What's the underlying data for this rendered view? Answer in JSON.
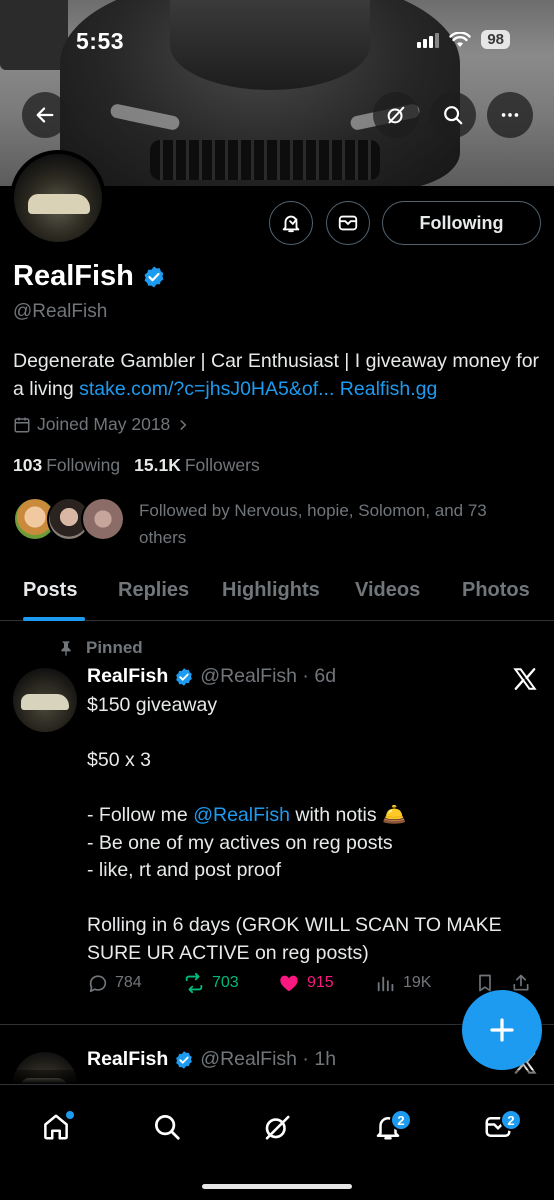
{
  "status_bar": {
    "time": "5:53",
    "battery": "98"
  },
  "profile": {
    "name": "RealFish",
    "handle": "@RealFish",
    "bio_text": "Degenerate Gambler | Car Enthusiast | I giveaway money for a living ",
    "bio_link1": "stake.com/?c=jhsJ0HA5&of...",
    "bio_link2": "Realfish.gg",
    "joined": "Joined May 2018",
    "following_count": "103",
    "following_label": "Following",
    "followers_count": "15.1K",
    "followers_label": "Followers",
    "followed_by": "Followed by Nervous, hopie, Solomon, and 73 others",
    "follow_button": "Following"
  },
  "tabs": [
    "Posts",
    "Replies",
    "Highlights",
    "Videos",
    "Photos"
  ],
  "pinned_label": "Pinned",
  "tweet": {
    "name": "RealFish",
    "handle_time": "@RealFish · 6d",
    "line1": "$150 giveaway",
    "line2": "$50 x 3",
    "line3a": "- Follow me ",
    "mention": "@RealFish",
    "line3b": " with notis 🛎️",
    "line4": "- Be one of my actives on reg posts",
    "line5": "- like, rt and post proof",
    "line6": "Rolling in 6 days (GROK WILL SCAN TO MAKE SURE UR ACTIVE on reg posts)",
    "replies": "784",
    "reposts": "703",
    "likes": "915",
    "views": "19K"
  },
  "tweet2": {
    "name": "RealFish",
    "handle_time": "@RealFish · 1h"
  },
  "nav": {
    "notifications_badge": "2",
    "messages_badge": "2"
  },
  "colors": {
    "accent": "#1d9bf0",
    "repost": "#00ba7c",
    "like": "#f91880",
    "muted": "#71767b"
  }
}
